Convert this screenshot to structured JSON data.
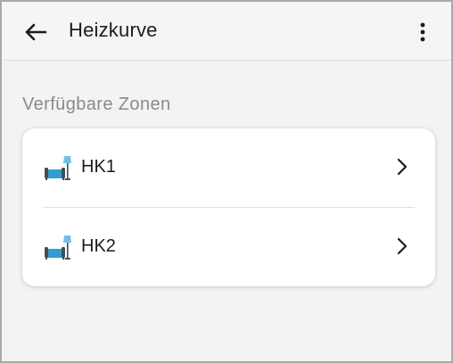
{
  "appbar": {
    "title": "Heizkurve",
    "back_icon": "arrow-left-icon",
    "menu_icon": "more-vert-icon"
  },
  "section": {
    "label": "Verfügbare Zonen"
  },
  "zones": [
    {
      "label": "HK1",
      "icon": "sofa-lamp-icon"
    },
    {
      "label": "HK2",
      "icon": "sofa-lamp-icon"
    }
  ],
  "colors": {
    "background": "#f4f3f4",
    "card": "#ffffff",
    "icon_accent": "#2f9fce",
    "icon_dark": "#3d4f5c",
    "text": "#1c1c1c",
    "muted_text": "#8b898c"
  }
}
